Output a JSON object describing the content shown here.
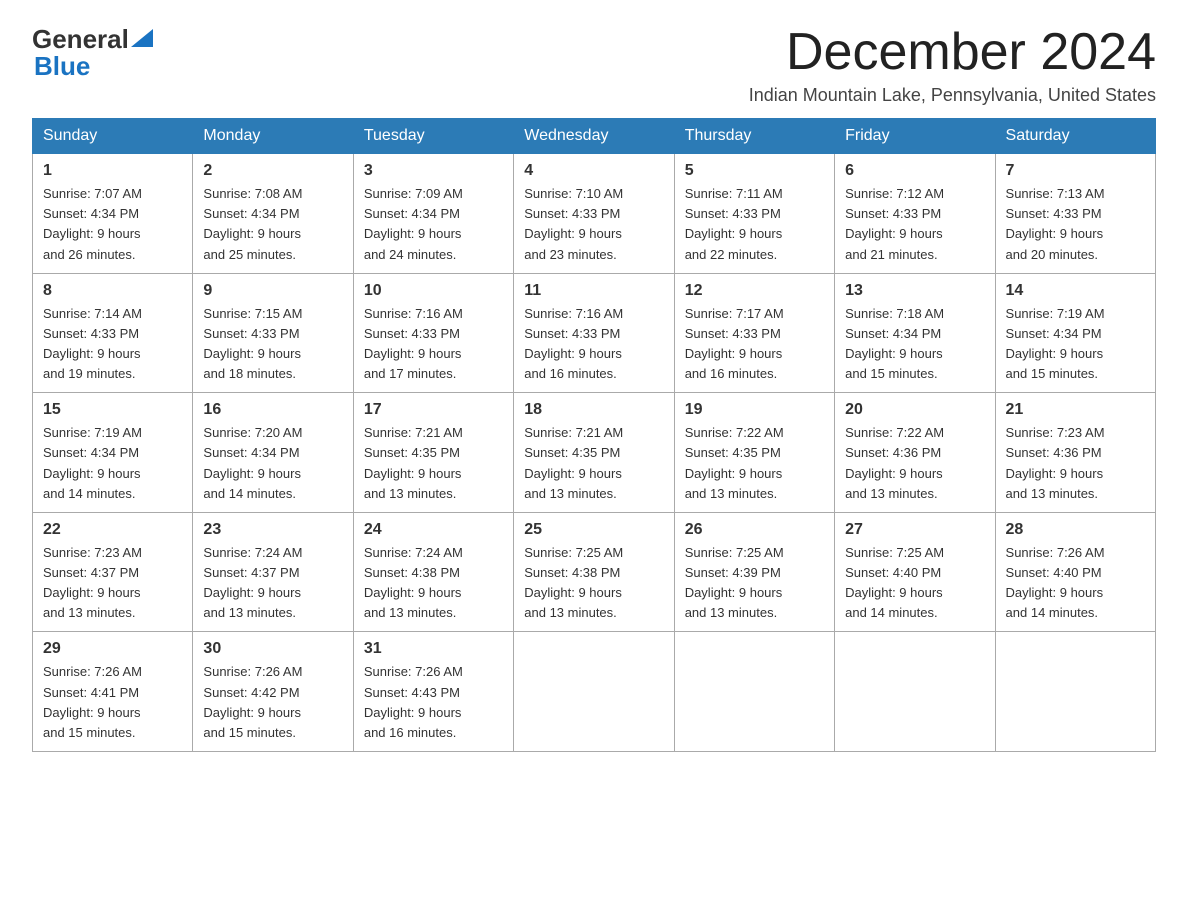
{
  "header": {
    "logo_text_general": "General",
    "logo_text_blue": "Blue",
    "month_title": "December 2024",
    "location": "Indian Mountain Lake, Pennsylvania, United States"
  },
  "days_of_week": [
    "Sunday",
    "Monday",
    "Tuesday",
    "Wednesday",
    "Thursday",
    "Friday",
    "Saturday"
  ],
  "weeks": [
    [
      {
        "day": "1",
        "sunrise": "7:07 AM",
        "sunset": "4:34 PM",
        "daylight": "9 hours and 26 minutes."
      },
      {
        "day": "2",
        "sunrise": "7:08 AM",
        "sunset": "4:34 PM",
        "daylight": "9 hours and 25 minutes."
      },
      {
        "day": "3",
        "sunrise": "7:09 AM",
        "sunset": "4:34 PM",
        "daylight": "9 hours and 24 minutes."
      },
      {
        "day": "4",
        "sunrise": "7:10 AM",
        "sunset": "4:33 PM",
        "daylight": "9 hours and 23 minutes."
      },
      {
        "day": "5",
        "sunrise": "7:11 AM",
        "sunset": "4:33 PM",
        "daylight": "9 hours and 22 minutes."
      },
      {
        "day": "6",
        "sunrise": "7:12 AM",
        "sunset": "4:33 PM",
        "daylight": "9 hours and 21 minutes."
      },
      {
        "day": "7",
        "sunrise": "7:13 AM",
        "sunset": "4:33 PM",
        "daylight": "9 hours and 20 minutes."
      }
    ],
    [
      {
        "day": "8",
        "sunrise": "7:14 AM",
        "sunset": "4:33 PM",
        "daylight": "9 hours and 19 minutes."
      },
      {
        "day": "9",
        "sunrise": "7:15 AM",
        "sunset": "4:33 PM",
        "daylight": "9 hours and 18 minutes."
      },
      {
        "day": "10",
        "sunrise": "7:16 AM",
        "sunset": "4:33 PM",
        "daylight": "9 hours and 17 minutes."
      },
      {
        "day": "11",
        "sunrise": "7:16 AM",
        "sunset": "4:33 PM",
        "daylight": "9 hours and 16 minutes."
      },
      {
        "day": "12",
        "sunrise": "7:17 AM",
        "sunset": "4:33 PM",
        "daylight": "9 hours and 16 minutes."
      },
      {
        "day": "13",
        "sunrise": "7:18 AM",
        "sunset": "4:34 PM",
        "daylight": "9 hours and 15 minutes."
      },
      {
        "day": "14",
        "sunrise": "7:19 AM",
        "sunset": "4:34 PM",
        "daylight": "9 hours and 15 minutes."
      }
    ],
    [
      {
        "day": "15",
        "sunrise": "7:19 AM",
        "sunset": "4:34 PM",
        "daylight": "9 hours and 14 minutes."
      },
      {
        "day": "16",
        "sunrise": "7:20 AM",
        "sunset": "4:34 PM",
        "daylight": "9 hours and 14 minutes."
      },
      {
        "day": "17",
        "sunrise": "7:21 AM",
        "sunset": "4:35 PM",
        "daylight": "9 hours and 13 minutes."
      },
      {
        "day": "18",
        "sunrise": "7:21 AM",
        "sunset": "4:35 PM",
        "daylight": "9 hours and 13 minutes."
      },
      {
        "day": "19",
        "sunrise": "7:22 AM",
        "sunset": "4:35 PM",
        "daylight": "9 hours and 13 minutes."
      },
      {
        "day": "20",
        "sunrise": "7:22 AM",
        "sunset": "4:36 PM",
        "daylight": "9 hours and 13 minutes."
      },
      {
        "day": "21",
        "sunrise": "7:23 AM",
        "sunset": "4:36 PM",
        "daylight": "9 hours and 13 minutes."
      }
    ],
    [
      {
        "day": "22",
        "sunrise": "7:23 AM",
        "sunset": "4:37 PM",
        "daylight": "9 hours and 13 minutes."
      },
      {
        "day": "23",
        "sunrise": "7:24 AM",
        "sunset": "4:37 PM",
        "daylight": "9 hours and 13 minutes."
      },
      {
        "day": "24",
        "sunrise": "7:24 AM",
        "sunset": "4:38 PM",
        "daylight": "9 hours and 13 minutes."
      },
      {
        "day": "25",
        "sunrise": "7:25 AM",
        "sunset": "4:38 PM",
        "daylight": "9 hours and 13 minutes."
      },
      {
        "day": "26",
        "sunrise": "7:25 AM",
        "sunset": "4:39 PM",
        "daylight": "9 hours and 13 minutes."
      },
      {
        "day": "27",
        "sunrise": "7:25 AM",
        "sunset": "4:40 PM",
        "daylight": "9 hours and 14 minutes."
      },
      {
        "day": "28",
        "sunrise": "7:26 AM",
        "sunset": "4:40 PM",
        "daylight": "9 hours and 14 minutes."
      }
    ],
    [
      {
        "day": "29",
        "sunrise": "7:26 AM",
        "sunset": "4:41 PM",
        "daylight": "9 hours and 15 minutes."
      },
      {
        "day": "30",
        "sunrise": "7:26 AM",
        "sunset": "4:42 PM",
        "daylight": "9 hours and 15 minutes."
      },
      {
        "day": "31",
        "sunrise": "7:26 AM",
        "sunset": "4:43 PM",
        "daylight": "9 hours and 16 minutes."
      },
      null,
      null,
      null,
      null
    ]
  ],
  "labels": {
    "sunrise": "Sunrise: ",
    "sunset": "Sunset: ",
    "daylight": "Daylight: "
  }
}
